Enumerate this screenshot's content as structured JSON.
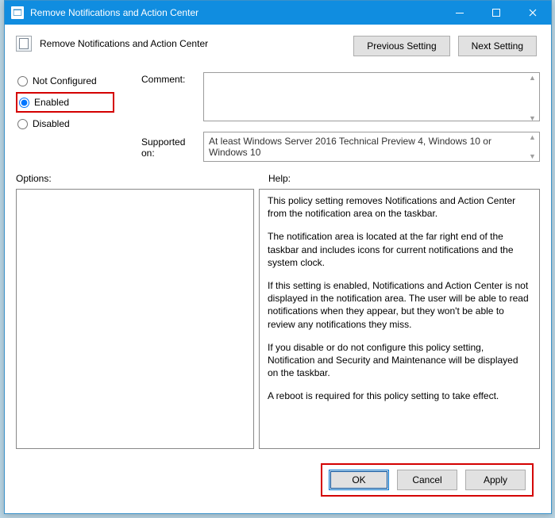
{
  "window": {
    "title": "Remove Notifications and Action Center"
  },
  "header": {
    "title": "Remove Notifications and Action Center",
    "previous": "Previous Setting",
    "next": "Next Setting"
  },
  "radios": {
    "not_configured": "Not Configured",
    "enabled": "Enabled",
    "disabled": "Disabled",
    "selected": "enabled"
  },
  "labels": {
    "comment": "Comment:",
    "supported": "Supported on:",
    "options": "Options:",
    "help": "Help:"
  },
  "fields": {
    "comment": "",
    "supported": "At least Windows Server 2016 Technical Preview 4, Windows 10 or Windows 10"
  },
  "help": {
    "p1": "This policy setting removes Notifications and Action Center from the notification area on the taskbar.",
    "p2": "The notification area is located at the far right end of the taskbar and includes icons for current notifications and the system clock.",
    "p3": "If this setting is enabled, Notifications and Action Center is not displayed in the notification area. The user will be able to read notifications when they appear, but they won't be able to review any notifications they miss.",
    "p4": "If you disable or do not configure this policy setting, Notification and Security and Maintenance will be displayed on the taskbar.",
    "p5": "A reboot is required for this policy setting to take effect."
  },
  "footer": {
    "ok": "OK",
    "cancel": "Cancel",
    "apply": "Apply"
  }
}
